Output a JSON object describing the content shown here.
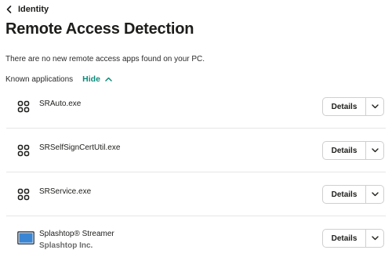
{
  "header": {
    "breadcrumb": "Identity",
    "title": "Remote Access Detection",
    "status_message": "There are no new remote access apps found on your PC."
  },
  "known_apps": {
    "label": "Known applications",
    "toggle_label": "Hide",
    "accent_color": "#0d8a7a",
    "items": [
      {
        "name": "SRAuto.exe",
        "publisher": "",
        "icon": "app-grid-icon",
        "button_label": "Details"
      },
      {
        "name": "SRSelfSignCertUtil.exe",
        "publisher": "",
        "icon": "app-grid-icon",
        "button_label": "Details"
      },
      {
        "name": "SRService.exe",
        "publisher": "",
        "icon": "app-grid-icon",
        "button_label": "Details"
      },
      {
        "name": "Splashtop® Streamer",
        "publisher": "Splashtop Inc.",
        "icon": "monitor-icon",
        "button_label": "Details"
      }
    ]
  }
}
